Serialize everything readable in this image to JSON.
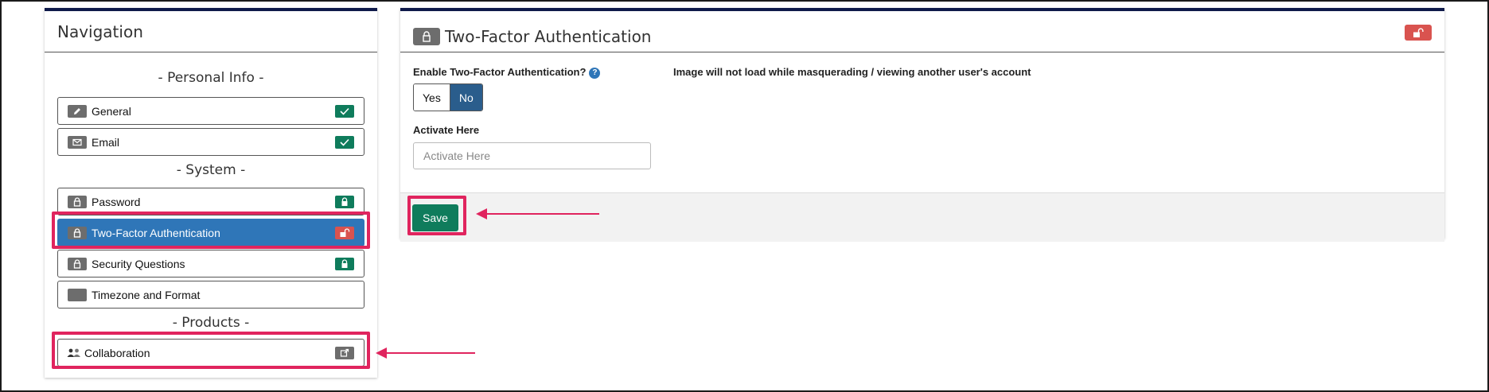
{
  "navigation": {
    "title": "Navigation",
    "sections": {
      "personal_info": "- Personal Info -",
      "system": "- System -",
      "products": "- Products -"
    },
    "items": [
      {
        "label": "General",
        "icon": "pencil-icon",
        "status": "check-icon",
        "status_color": "#0f7c5c"
      },
      {
        "label": "Email",
        "icon": "envelope-icon",
        "status": "check-icon",
        "status_color": "#0f7c5c"
      },
      {
        "label": "Password",
        "icon": "lock-icon",
        "status": "lock-icon",
        "status_color": "#0f7c5c"
      },
      {
        "label": "Two-Factor Authentication",
        "icon": "lock-icon",
        "status": "unlock-icon",
        "status_color": "#d9534f",
        "active": true
      },
      {
        "label": "Security Questions",
        "icon": "lock-icon",
        "status": "lock-icon",
        "status_color": "#0f7c5c"
      },
      {
        "label": "Timezone and Format",
        "icon": "blank-icon"
      },
      {
        "label": "Collaboration",
        "icon": "people-icon",
        "status": "external-link-icon",
        "status_color": "#6d6d6d"
      }
    ]
  },
  "main": {
    "title": "Two-Factor Authentication",
    "title_icon": "lock-icon",
    "header_badge_icon": "unlock-icon",
    "enable_label": "Enable Two-Factor Authentication?",
    "help_icon_text": "?",
    "toggle": {
      "yes_label": "Yes",
      "no_label": "No",
      "selected": "No"
    },
    "image_notice": "Image will not load while masquerading / viewing another user's account",
    "activate_label": "Activate Here",
    "activate_input": {
      "value": "",
      "placeholder": "Activate Here"
    },
    "save_label": "Save"
  },
  "colors": {
    "accent": "#2f76b8",
    "success": "#0f7c5c",
    "danger": "#d9534f",
    "highlight": "#e0245e"
  }
}
